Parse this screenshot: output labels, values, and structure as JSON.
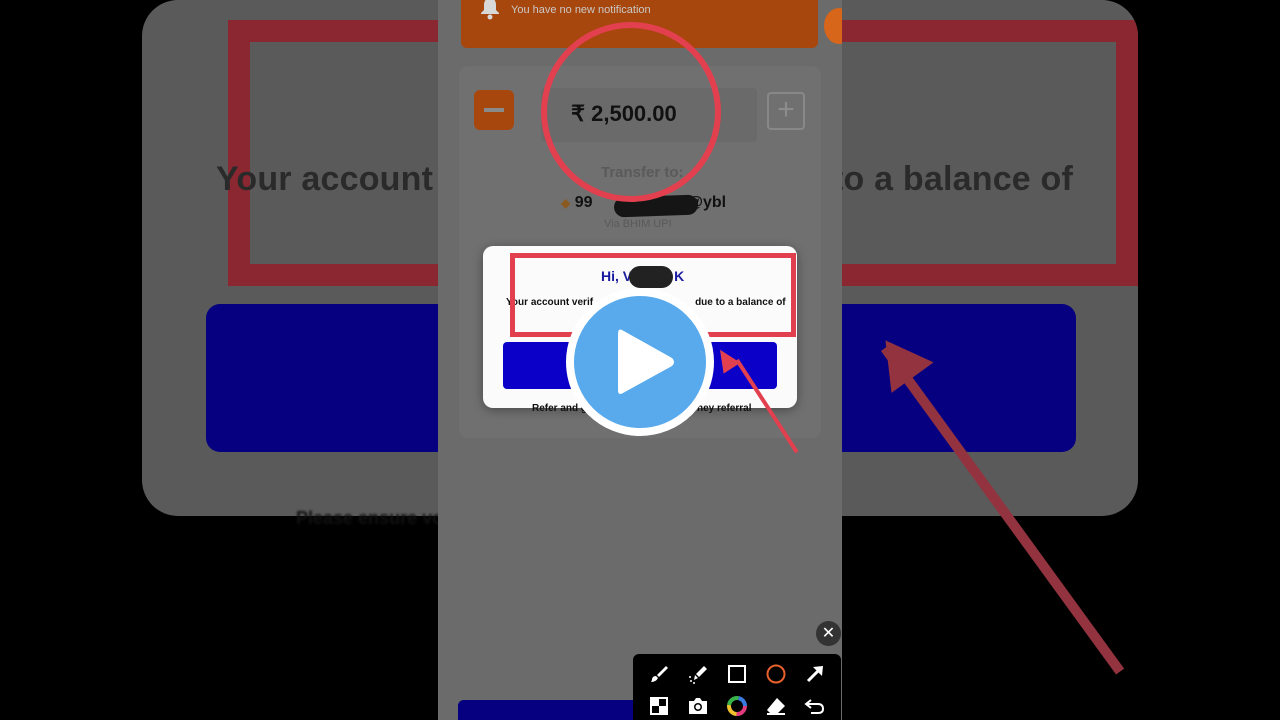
{
  "background": {
    "zoomed_message_left": "Your account v",
    "zoomed_message_right": "to a balance of",
    "below_text": "Please ensure you refer and get a referral"
  },
  "notification": {
    "text": "You have no new notification"
  },
  "transfer": {
    "amount": "₹ 2,500.00",
    "transfer_to_label": "Transfer to:",
    "upi_prefix": "99",
    "upi_suffix": "2@ybl",
    "via_label": "Via BHIM UPI",
    "minus_label": "−",
    "plus_label": "+"
  },
  "dialog": {
    "greeting_start": "Hi, V",
    "greeting_end": "K",
    "message_left": "Your account verif",
    "message_right": "due to a balance of",
    "under_text_left": "Refer and g",
    "under_text_right": "ney referral"
  },
  "annotation_toolbar": {
    "tools_row1": [
      "brush-icon",
      "highlighter-icon",
      "rectangle-icon",
      "circle-icon",
      "arrow-icon"
    ],
    "tools_row2": [
      "mosaic-icon",
      "camera-icon",
      "color-picker-icon",
      "eraser-icon",
      "undo-icon"
    ],
    "close_label": "✕"
  },
  "colors": {
    "annotation_red": "#e2404f",
    "button_blue": "#0a00c8",
    "play_blue": "#58aaec",
    "orange": "#a8470d"
  }
}
